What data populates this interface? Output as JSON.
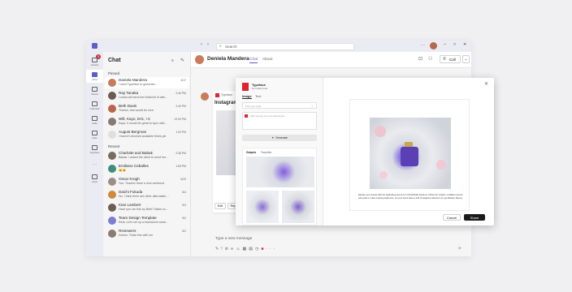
{
  "search": {
    "placeholder": "Search"
  },
  "window_controls": {
    "more": "···",
    "minimize": "–",
    "maximize": "□",
    "close": "✕"
  },
  "apps": [
    {
      "label": "Activity"
    },
    {
      "label": "Chat"
    },
    {
      "label": "Teams"
    },
    {
      "label": "Calendar"
    },
    {
      "label": "Calls"
    },
    {
      "label": "Files"
    },
    {
      "label": "Typeface"
    },
    {
      "label": "···"
    },
    {
      "label": "Apps"
    }
  ],
  "activity_badge": "3",
  "chatlist": {
    "title": "Chat",
    "pinned_label": "Pinned",
    "recent_label": "Recent",
    "pinned": [
      {
        "name": "Daniela Mandera",
        "preview": "I used Typeface to generate...",
        "time": "4/17",
        "color": "#c97b5a"
      },
      {
        "name": "Ray Tanaka",
        "preview": "Louisa will send the initial list of atte...",
        "time": "2:40 PM",
        "color": "#6a5a52"
      },
      {
        "name": "Beth Davis",
        "preview": "Thanks, that would be nice.",
        "time": "2:40 PM",
        "color": "#b9664c"
      },
      {
        "name": "Will, Kayo, Eric, +2",
        "preview": "Kayo: It would be great to sync with...",
        "time": "12:00 PM",
        "color": "#8a7a6e"
      },
      {
        "name": "August Bergman",
        "preview": "I haven't checked available times yet",
        "time": "1:20 PM",
        "color": "#e1dfdd"
      }
    ],
    "recent": [
      {
        "name": "Charlotte and Babak",
        "preview": "Babak: I asked the client to send her feed...",
        "time": "2:38 PM",
        "color": "#7b6a60"
      },
      {
        "name": "Emiliano Ceballos",
        "preview": "😀😀",
        "time": "1:55 PM",
        "color": "#3e8e7e"
      },
      {
        "name": "Oscar Krogh",
        "preview": "You: Thanks! Have a nice weekend",
        "time": "6/23",
        "color": "#9a8f86"
      },
      {
        "name": "Daichi Fukuda",
        "preview": "No, I think there are other alternatives we c...",
        "time": "6/4",
        "color": "#d08a3a"
      },
      {
        "name": "Kian Lambert",
        "preview": "Have you ran this by Beth? Make sure she's...",
        "time": "5/3",
        "color": "#6d5d55"
      },
      {
        "name": "Team Design Template",
        "preview": "Reta: Let's set up a brainstorm session for...",
        "time": "5/2",
        "color": "#7a7fd4"
      },
      {
        "name": "Reviewers",
        "preview": "Darren: Thats fine with me",
        "time": "5/2",
        "color": "#8b7c72"
      }
    ]
  },
  "conversation": {
    "name": "Deniela Mandera",
    "tabs": [
      "Chat",
      "About"
    ],
    "call_label": "Call",
    "message_sender": "Typeface",
    "card_title": "Instagram",
    "edit_label": "Edit",
    "rep_label": "Rep",
    "compose_placeholder": "Type a new message"
  },
  "dialog": {
    "brand": "Typeface",
    "brand_sub": "AI content tool",
    "tabs": [
      "Image",
      "Text"
    ],
    "select_placeholder": "Pick your style",
    "prompt_placeholder": "Start typing your text description",
    "generate_label": "Generate",
    "results_tabs": [
      "Outputs",
      "Favorites"
    ],
    "caption": "Elevate your senses with the captivating aroma of © Floral Bottle Perfume. Perfect for modern, confident women who want to make a lasting statement. Let your scent leave a trail of elegance wherever you go #beauty #luxury",
    "cancel_label": "Cancel",
    "share_label": "Share"
  }
}
